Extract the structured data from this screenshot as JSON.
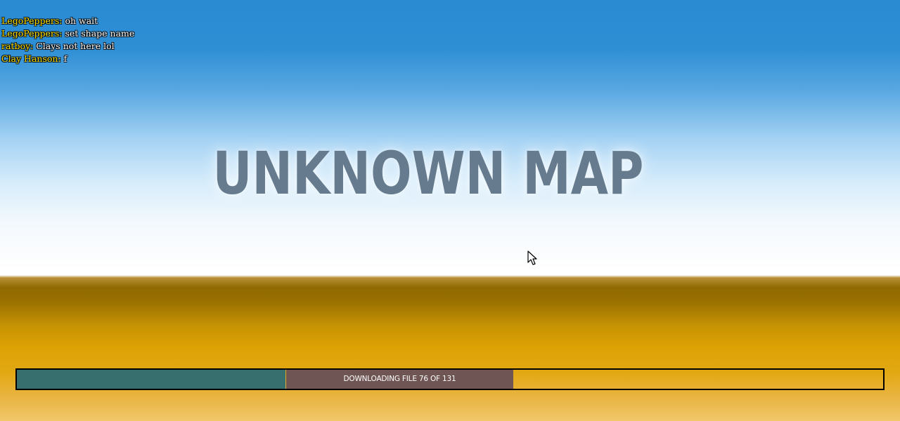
{
  "chat": {
    "messages": [
      {
        "name": "LegoPeppers",
        "text": "oh wait"
      },
      {
        "name": "LegoPeppers",
        "text": "set shape name"
      },
      {
        "name": "ratboy",
        "text": "Clays not here lol"
      },
      {
        "name": "Clay Hanson",
        "text": "f"
      }
    ],
    "name_color": "#ffe300",
    "text_color": "#ffffff"
  },
  "map_title": "UNKNOWN MAP",
  "loading": {
    "status_text": "DOWNLOADING FILE 76 OF 131",
    "current_file": 76,
    "total_files": 131,
    "progress_fraction": 0.31
  },
  "colors": {
    "sky_top": "#2a8ad2",
    "horizon": "#ffffff",
    "ground": "#dda204",
    "progress_fill": "#366f6e",
    "label_bg": "#6f5554",
    "title_color": "#667b8d"
  },
  "cursor": {
    "icon": "arrow-cursor-icon"
  }
}
